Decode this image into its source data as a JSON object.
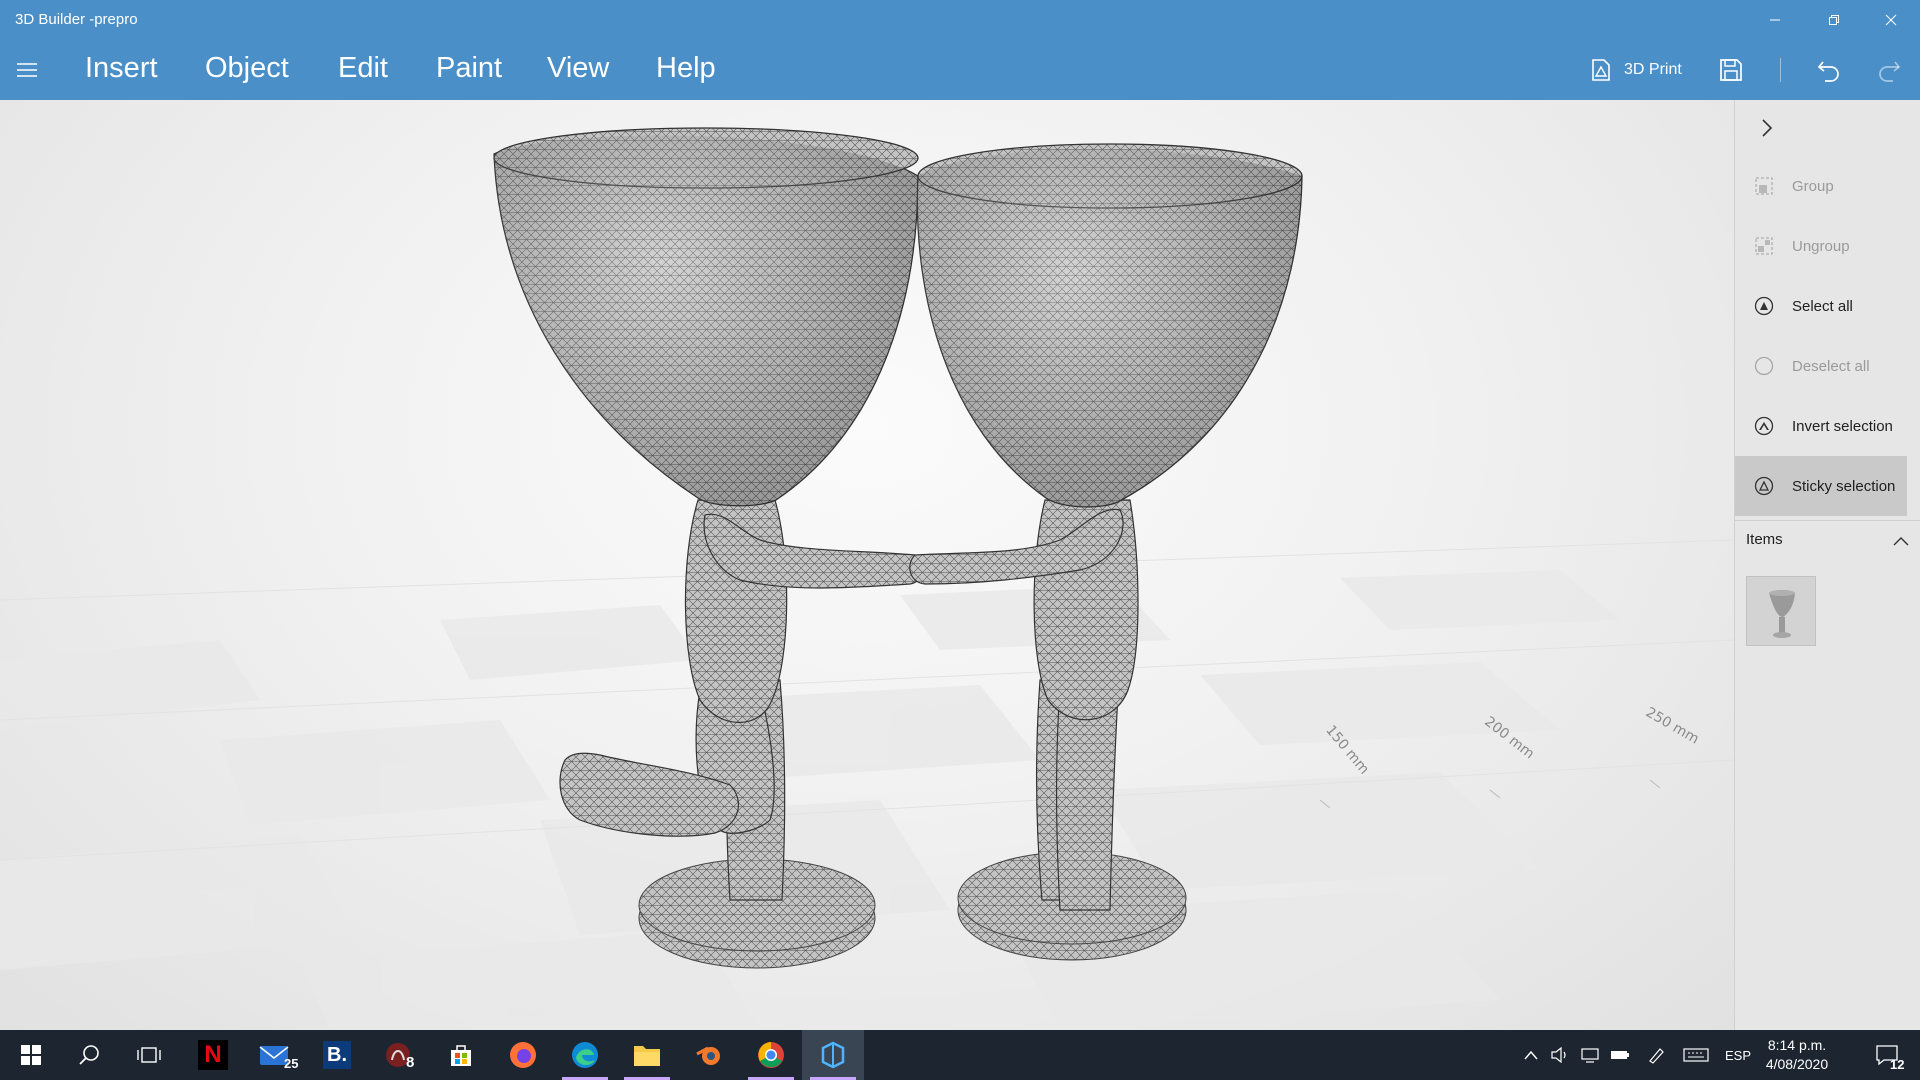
{
  "window": {
    "title": "3D Builder -prepro",
    "minimize_icon": "minimize-icon",
    "restore_icon": "restore-icon",
    "close_icon": "close-icon"
  },
  "menubar": {
    "menu_icon": "hamburger-icon",
    "items": [
      "Insert",
      "Object",
      "Edit",
      "Paint",
      "View",
      "Help"
    ],
    "print_label": "3D Print",
    "save_icon": "save-icon",
    "undo_icon": "undo-icon",
    "redo_icon": "redo-icon"
  },
  "viewport": {
    "ruler_labels": [
      "150 mm",
      "200 mm",
      "250 mm"
    ]
  },
  "sidepanel": {
    "collapse_icon": "chevron-right-icon",
    "items": [
      {
        "label": "Group",
        "enabled": false,
        "icon": "group-icon"
      },
      {
        "label": "Ungroup",
        "enabled": false,
        "icon": "ungroup-icon"
      },
      {
        "label": "Select all",
        "enabled": true,
        "icon": "select-all-icon"
      },
      {
        "label": "Deselect all",
        "enabled": false,
        "icon": "deselect-all-icon"
      },
      {
        "label": "Invert selection",
        "enabled": true,
        "icon": "invert-selection-icon"
      },
      {
        "label": "Sticky selection",
        "enabled": true,
        "active": true,
        "icon": "sticky-selection-icon"
      }
    ],
    "items_header": "Items",
    "items_toggle_icon": "chevron-up-icon"
  },
  "taskbar": {
    "apps": [
      "start",
      "search",
      "task-view",
      "netflix",
      "mail",
      "booking",
      "app-badge",
      "store",
      "firefox",
      "edge",
      "file-explorer",
      "blender",
      "chrome",
      "3d-builder"
    ],
    "mail_badge": "25",
    "app_badge": "8",
    "language": "ESP",
    "time": "8:14 p.m.",
    "date": "4/08/2020",
    "notification_badge": "12",
    "accent": "#c9a7ff"
  },
  "colors": {
    "titlebar": "#4a8fc8",
    "panel": "#e6e6e6",
    "taskbar": "#1c2530"
  }
}
